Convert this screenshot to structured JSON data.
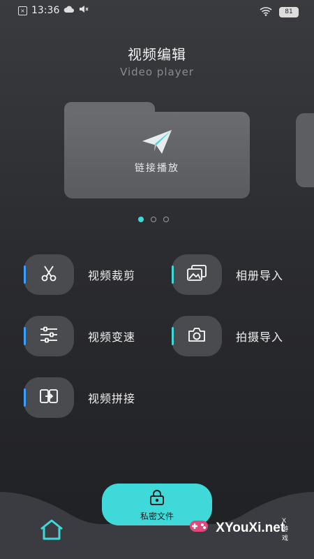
{
  "status_bar": {
    "time": "13:36",
    "battery": "81"
  },
  "header": {
    "title": "视频编辑",
    "subtitle": "Video player"
  },
  "carousel": {
    "card_label": "链接播放",
    "pages": 3,
    "active_page": 1
  },
  "features": [
    {
      "label": "视频裁剪",
      "icon": "scissors-icon",
      "accent": "#3aa0ff"
    },
    {
      "label": "相册导入",
      "icon": "gallery-icon",
      "accent": "#3fd9d9"
    },
    {
      "label": "视频变速",
      "icon": "sliders-icon",
      "accent": "#3aa0ff"
    },
    {
      "label": "拍摄导入",
      "icon": "camera-icon",
      "accent": "#3fd9d9"
    },
    {
      "label": "视频拼接",
      "icon": "merge-icon",
      "accent": "#3aa0ff"
    }
  ],
  "bottom": {
    "private_files_label": "私密文件"
  },
  "watermark": {
    "text": "XYouXi.net",
    "tag": "X游戏"
  },
  "colors": {
    "accent": "#3fd9d9",
    "background": "#2b2c30"
  }
}
